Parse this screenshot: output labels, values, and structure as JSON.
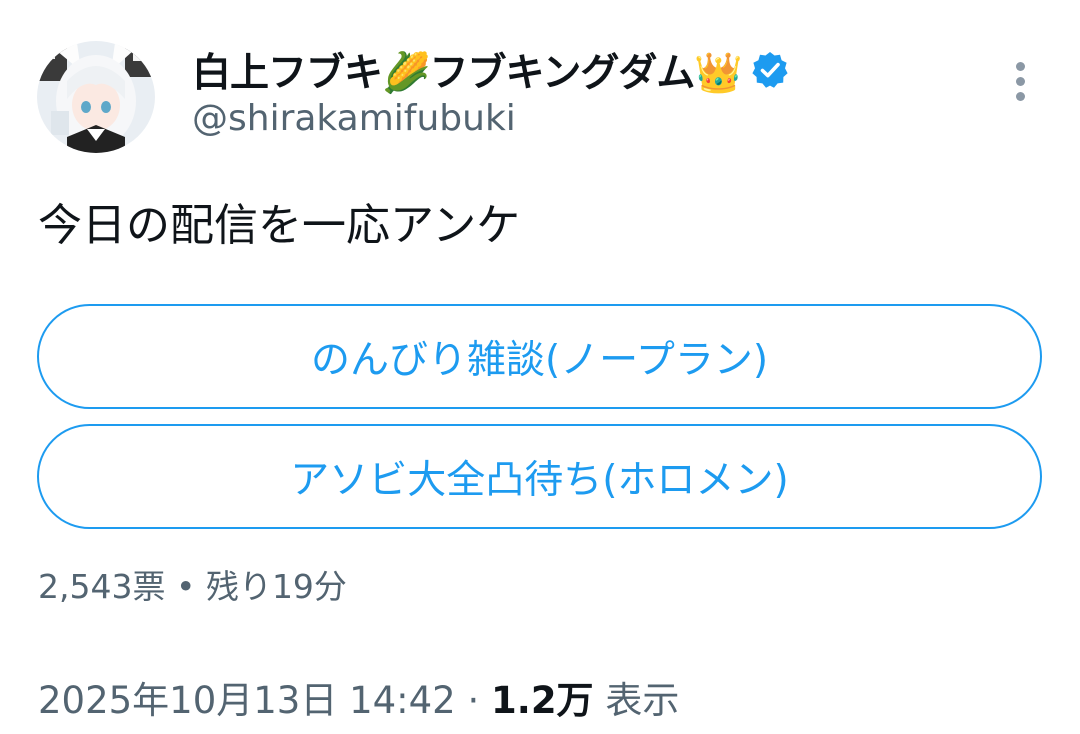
{
  "author": {
    "display_name": "白上フブキ🌽フブキングダム👑",
    "handle": "@shirakamifubuki",
    "verified": true
  },
  "tweet": {
    "text": "今日の配信を一応アンケ"
  },
  "poll": {
    "options": [
      {
        "label": "のんびり雑談(ノープラン)"
      },
      {
        "label": "アソビ大全凸待ち(ホロメン)"
      }
    ],
    "votes": "2,543票",
    "separator": " • ",
    "time_left": "残り19分"
  },
  "meta": {
    "timestamp": "2025年10月13日 14:42",
    "dot": " · ",
    "views_count": "1.2万",
    "views_label": " 表示"
  },
  "colors": {
    "accent": "#1d9bf0",
    "secondary_text": "#536471",
    "primary_text": "#0f1419"
  },
  "icons": {
    "verified": "verified-badge-icon",
    "more": "more-vertical-icon"
  }
}
